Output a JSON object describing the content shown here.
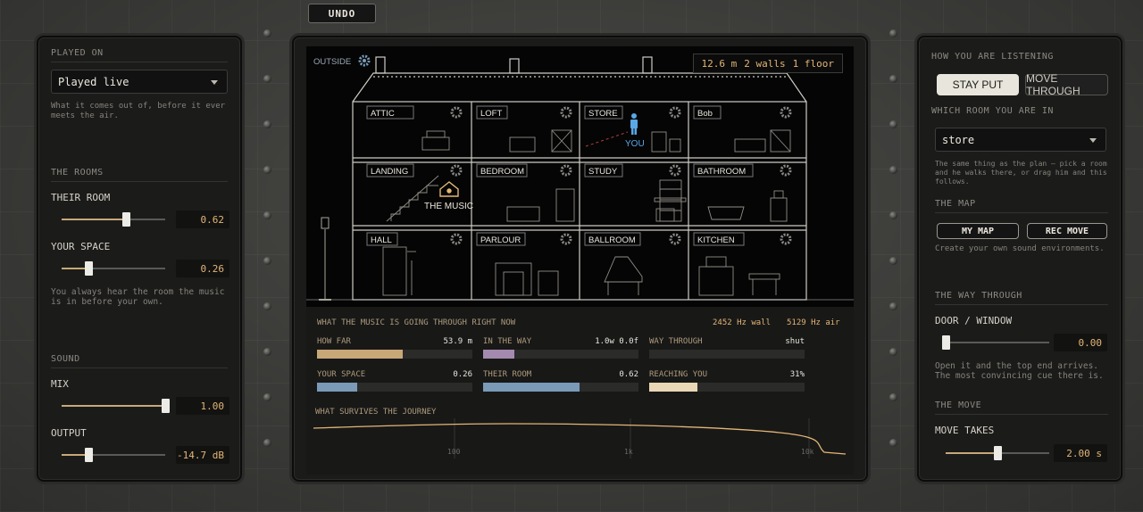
{
  "toolbar": {
    "undo_label": "UNDO"
  },
  "left": {
    "played_on": {
      "title": "PLAYED ON",
      "value": "Played live",
      "help": "What it comes out of, before it ever meets the air."
    },
    "rooms": {
      "title": "THE ROOMS",
      "their_room": {
        "label": "THEIR ROOM",
        "value": "0.62",
        "fraction": 0.62
      },
      "your_space": {
        "label": "YOUR SPACE",
        "value": "0.26",
        "fraction": 0.26
      },
      "help": "You always hear the room the music is in before your own."
    },
    "sound": {
      "title": "SOUND",
      "mix": {
        "label": "MIX",
        "value": "1.00",
        "fraction": 1.0
      },
      "output": {
        "label": "OUTPUT",
        "value": "-14.7 dB",
        "fraction": 0.26
      }
    }
  },
  "house": {
    "outside_label": "OUTSIDE",
    "info": {
      "distance": "12.6 m",
      "walls": "2 walls",
      "floors": "1 floor"
    },
    "rooms": [
      "ATTIC",
      "LOFT",
      "STORE",
      "Bob",
      "LANDING",
      "BEDROOM",
      "STUDY",
      "BATHROOM",
      "HALL",
      "PARLOUR",
      "BALLROOM",
      "KITCHEN"
    ],
    "you_label": "YOU",
    "music_label": "THE MUSIC"
  },
  "meters": {
    "title": "WHAT THE MUSIC IS GOING THROUGH RIGHT NOW",
    "wall_hz": "2452 Hz wall",
    "air_hz": "5129 Hz air",
    "items": [
      {
        "label": "HOW FAR",
        "value": "53.9 m",
        "fraction": 0.55,
        "color": "#c9a878"
      },
      {
        "label": "IN THE WAY",
        "value": "1.0w 0.0f",
        "fraction": 0.2,
        "color": "#a58ab0"
      },
      {
        "label": "WAY THROUGH",
        "value": "shut",
        "fraction": 0.0,
        "color": "#c9a878"
      },
      {
        "label": "YOUR SPACE",
        "value": "0.26",
        "fraction": 0.26,
        "color": "#7a9ab8"
      },
      {
        "label": "THEIR ROOM",
        "value": "0.62",
        "fraction": 0.62,
        "color": "#7a9ab8"
      },
      {
        "label": "REACHING YOU",
        "value": "31%",
        "fraction": 0.31,
        "color": "#ead7b5"
      }
    ],
    "survives_title": "WHAT SURVIVES THE JOURNEY",
    "freq_ticks": [
      "100",
      "1k",
      "10k"
    ]
  },
  "right": {
    "listening": {
      "title": "HOW YOU ARE LISTENING",
      "stay_put": "STAY PUT",
      "move_through": "MOVE THROUGH"
    },
    "which_room": {
      "title": "WHICH ROOM YOU ARE IN",
      "value": "store",
      "help": "The same thing as the plan — pick a room and he walks there, or drag him and this follows."
    },
    "map": {
      "title": "THE MAP",
      "my_map": "MY MAP",
      "rec_move": "REC MOVE",
      "help": "Create your own sound environments."
    },
    "way_through": {
      "title": "THE WAY THROUGH",
      "door": {
        "label": "DOOR / WINDOW",
        "value": "0.00",
        "fraction": 0.0
      },
      "help": "Open it and the top end arrives. The most convincing cue there is."
    },
    "move": {
      "title": "THE MOVE",
      "takes": {
        "label": "MOVE TAKES",
        "value": "2.00 s",
        "fraction": 0.5
      }
    }
  }
}
